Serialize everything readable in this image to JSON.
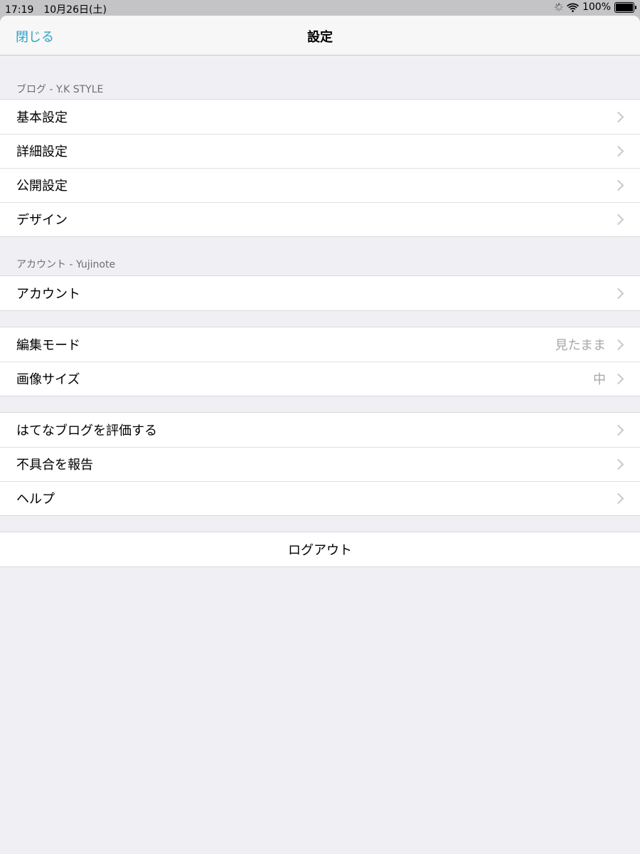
{
  "status_bar": {
    "time": "17:19",
    "date": "10月26日(土)",
    "battery": "100%",
    "battery_level": 1.0
  },
  "navbar": {
    "close_label": "閉じる",
    "title": "設定"
  },
  "sections": {
    "blog": {
      "header": "ブログ - Y.K  STYLE",
      "items": [
        {
          "label": "基本設定"
        },
        {
          "label": "詳細設定"
        },
        {
          "label": "公開設定"
        },
        {
          "label": "デザイン"
        }
      ]
    },
    "account": {
      "header": "アカウント - Yujinote",
      "items": [
        {
          "label": "アカウント"
        }
      ]
    },
    "editor": {
      "items": [
        {
          "label": "編集モード",
          "value": "見たまま"
        },
        {
          "label": "画像サイズ",
          "value": "中"
        }
      ]
    },
    "support": {
      "items": [
        {
          "label": "はてなブログを評価する"
        },
        {
          "label": "不具合を報告"
        },
        {
          "label": "ヘルプ"
        }
      ]
    },
    "logout": {
      "label": "ログアウト"
    }
  },
  "colors": {
    "accent": "#2aa2c9",
    "background": "#efeff4",
    "secondary_text": "#6d6d72",
    "value_text": "#a8a8ad"
  }
}
